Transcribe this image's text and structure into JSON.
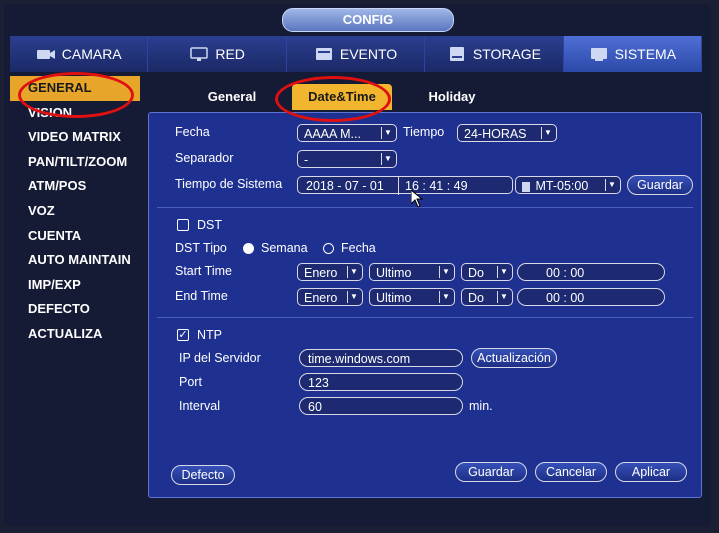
{
  "window": {
    "title": "CONFIG"
  },
  "main_tabs": [
    {
      "label": "CAMARA",
      "icon": "camera-icon"
    },
    {
      "label": "RED",
      "icon": "network-icon"
    },
    {
      "label": "EVENTO",
      "icon": "event-icon"
    },
    {
      "label": "STORAGE",
      "icon": "storage-icon"
    },
    {
      "label": "SISTEMA",
      "icon": "system-icon",
      "active": true
    }
  ],
  "sidebar": {
    "items": [
      {
        "label": "GENERAL",
        "active": true
      },
      {
        "label": "VISION"
      },
      {
        "label": "VIDEO MATRIX"
      },
      {
        "label": "PAN/TILT/ZOOM"
      },
      {
        "label": "ATM/POS"
      },
      {
        "label": "VOZ"
      },
      {
        "label": "CUENTA"
      },
      {
        "label": "AUTO MAINTAIN"
      },
      {
        "label": "IMP/EXP"
      },
      {
        "label": "DEFECTO"
      },
      {
        "label": "ACTUALIZA"
      }
    ]
  },
  "sub_tabs": [
    {
      "label": "General"
    },
    {
      "label": "Date&Time",
      "active": true
    },
    {
      "label": "Holiday"
    }
  ],
  "form": {
    "fecha_label": "Fecha",
    "fecha_value": "AAAA M...",
    "tiempo_label": "Tiempo",
    "tiempo_value": "24-HORAS",
    "separador_label": "Separador",
    "separador_value": "-",
    "tiempo_sistema_label": "Tiempo de Sistema",
    "date_value": "2018 - 07 - 01",
    "time_value": "16 : 41 : 49",
    "timezone_value": "MT-05:00",
    "guardar_label": "Guardar",
    "dst_label": "DST",
    "dst_tipo_label": "DST Tipo",
    "semana_label": "Semana",
    "fecha_option_label": "Fecha",
    "start_time_label": "Start Time",
    "end_time_label": "End Time",
    "start": {
      "month": "Enero",
      "week": "Ultimo",
      "day": "Do",
      "time": "00 : 00"
    },
    "end": {
      "month": "Enero",
      "week": "Ultimo",
      "day": "Do",
      "time": "00 : 00"
    },
    "ntp_label": "NTP",
    "ntp_checked": true,
    "ip_servidor_label": "IP del Servidor",
    "ip_servidor_value": "time.windows.com",
    "actualizacion_label": "Actualización",
    "port_label": "Port",
    "port_value": "123",
    "interval_label": "Interval",
    "interval_value": "60",
    "interval_unit": "min."
  },
  "footer": {
    "defecto_label": "Defecto",
    "guardar_label": "Guardar",
    "cancelar_label": "Cancelar",
    "aplicar_label": "Aplicar"
  },
  "colors": {
    "background": "#151a35",
    "panel": "#1e3191",
    "accent": "#f2b62e",
    "highlight_circle": "#e01010"
  }
}
